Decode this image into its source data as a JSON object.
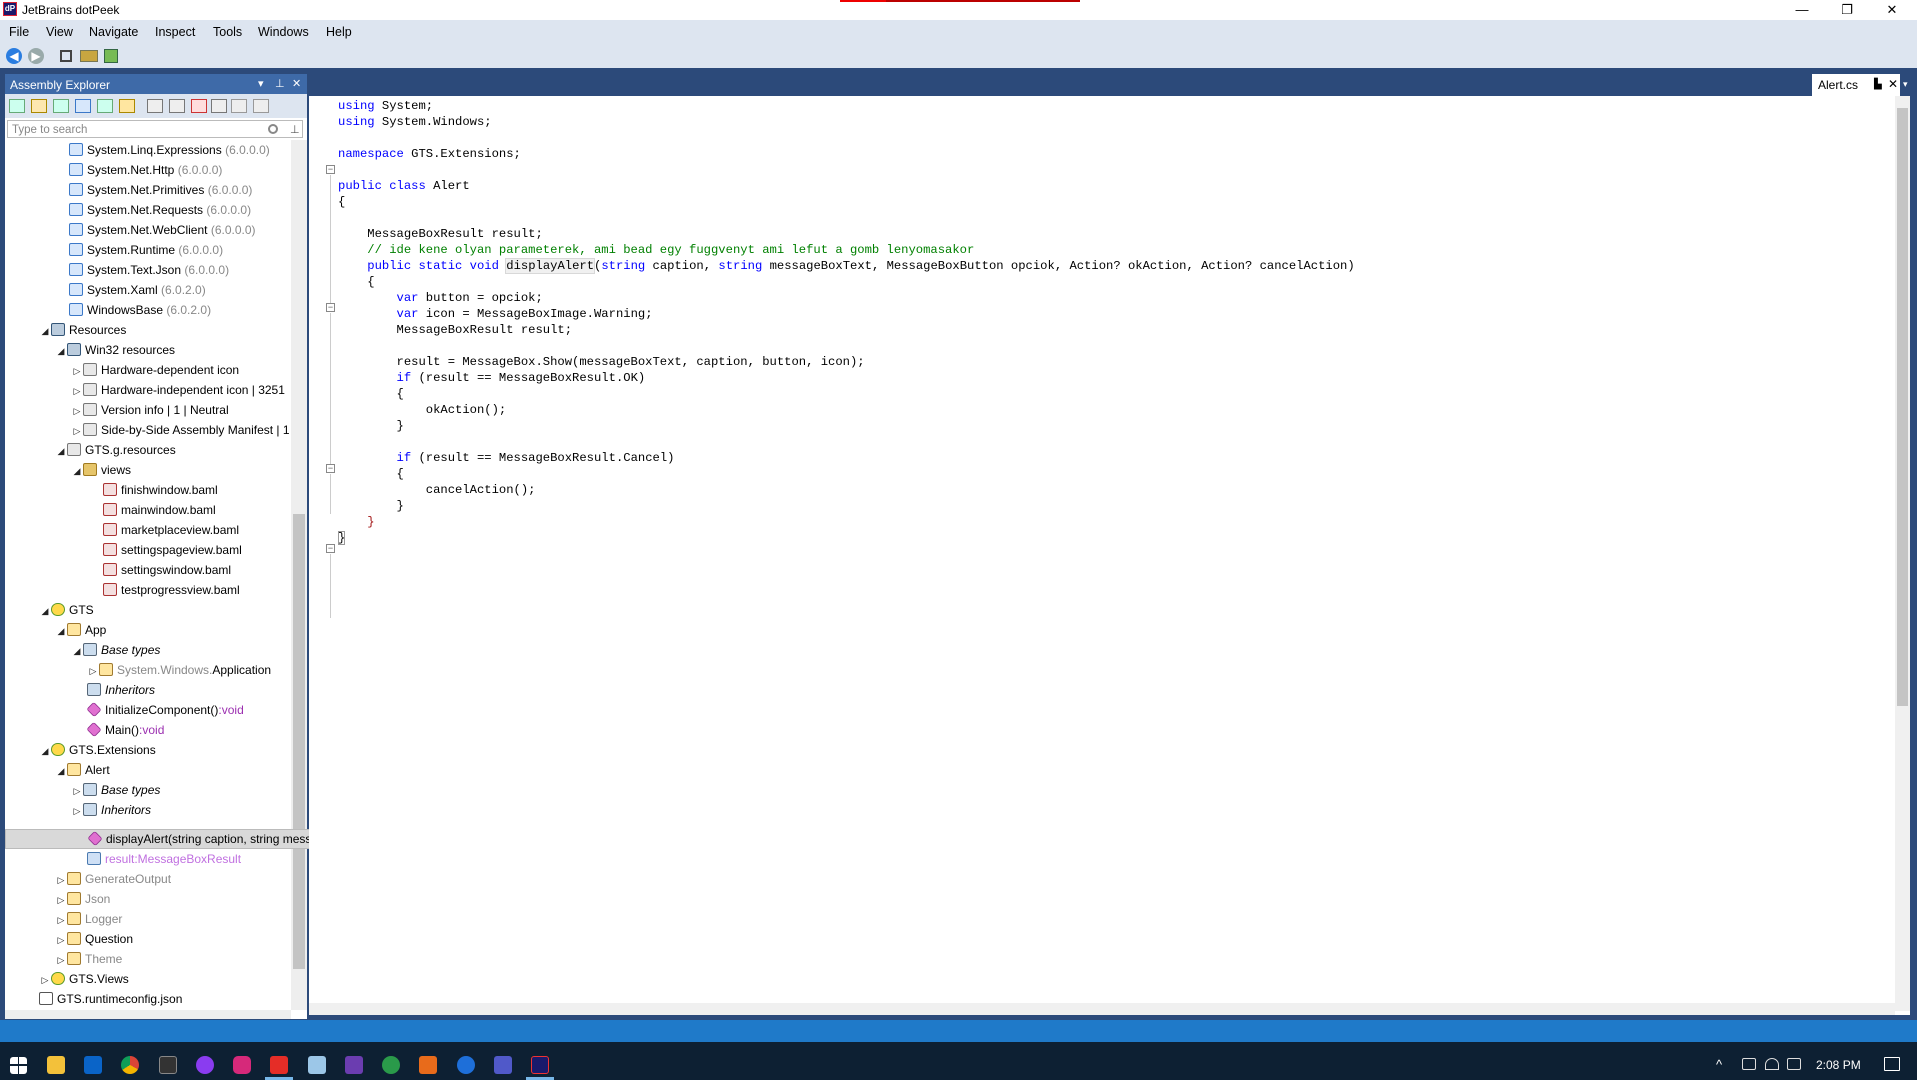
{
  "window": {
    "title": "JetBrains dotPeek",
    "app_icon": "dotpeek-icon",
    "min_label": "—",
    "max_label": "❐",
    "close_label": "✕"
  },
  "menu": [
    "File",
    "View",
    "Navigate",
    "Inspect",
    "Tools",
    "Windows",
    "Help"
  ],
  "toolbar": {
    "back_glyph": "◀",
    "forward_glyph": "▶"
  },
  "explorer": {
    "title": "Assembly Explorer",
    "header_dropdown": "▾",
    "header_pin": "⊥",
    "header_close": "✕",
    "search_placeholder": "Type to search",
    "pin_glyph": "⊥"
  },
  "tree": [
    {
      "name": "System.Linq.Expressions",
      "version": "(6.0.0.0)"
    },
    {
      "name": "System.Net.Http",
      "version": "(6.0.0.0)"
    },
    {
      "name": "System.Net.Primitives",
      "version": "(6.0.0.0)"
    },
    {
      "name": "System.Net.Requests",
      "version": "(6.0.0.0)"
    },
    {
      "name": "System.Net.WebClient",
      "version": "(6.0.0.0)"
    },
    {
      "name": "System.Runtime",
      "version": "(6.0.0.0)"
    },
    {
      "name": "System.Text.Json",
      "version": "(6.0.0.0)"
    },
    {
      "name": "System.Xaml",
      "version": "(6.0.2.0)"
    },
    {
      "name": "WindowsBase",
      "version": "(6.0.2.0)"
    },
    {
      "name": "Resources"
    },
    {
      "name": "Win32 resources"
    },
    {
      "name": "Hardware-dependent icon"
    },
    {
      "name": "Hardware-independent icon | 3251"
    },
    {
      "name": "Version info | 1 | Neutral"
    },
    {
      "name": "Side-by-Side Assembly Manifest | 1"
    },
    {
      "name": "GTS.g.resources"
    },
    {
      "name": "views"
    },
    {
      "name": "finishwindow.baml"
    },
    {
      "name": "mainwindow.baml"
    },
    {
      "name": "marketplaceview.baml"
    },
    {
      "name": "settingspageview.baml"
    },
    {
      "name": "settingswindow.baml"
    },
    {
      "name": "testprogressview.baml"
    },
    {
      "name": "GTS"
    },
    {
      "name": "App"
    },
    {
      "name": "Base types"
    },
    {
      "name_prefix": "System.Windows.",
      "name": "Application"
    },
    {
      "name": "Inheritors"
    },
    {
      "name": "InitializeComponent()",
      "suffix": ":void"
    },
    {
      "name": "Main()",
      "suffix": ":void"
    },
    {
      "name": "GTS.Extensions"
    },
    {
      "name": "Alert"
    },
    {
      "name": "Base types"
    },
    {
      "name": "Inheritors"
    },
    {
      "name": "displayAlert(string caption, string messageBoxText, MessageBoxButton opciok, Action? okAction, Action? cancelAction):void"
    },
    {
      "name": "result:MessageBoxResult"
    },
    {
      "name": "GenerateOutput"
    },
    {
      "name": "Json"
    },
    {
      "name": "Logger"
    },
    {
      "name": "Question"
    },
    {
      "name": "Theme"
    },
    {
      "name": "GTS.Views"
    },
    {
      "name": "GTS.runtimeconfig.json"
    }
  ],
  "editor": {
    "tab_label": "Alert.cs",
    "tab_pin": "▙",
    "tab_close": "✕",
    "tab_dropdown": "▾",
    "code": {
      "l1_kw": "using",
      "l1_rest": " System;",
      "l2_kw": "using",
      "l2_rest": " System.Windows;",
      "l4_kw": "namespace",
      "l4_rest": " GTS.Extensions;",
      "l6_kw1": "public",
      "l6_kw2": " class",
      "l6_rest": " Alert",
      "l7": "{",
      "l9": "    MessageBoxResult result;",
      "l10": "    // ide kene olyan parameterek, ami bead egy fuggvenyt ami lefut a gomb lenyomasakor",
      "l11_indent": "    ",
      "l11_kw": "public static void",
      "l11_sp": " ",
      "l11_name": "displayAlert",
      "l11_p1": "(",
      "l11_t1": "string",
      "l11_p2": " caption, ",
      "l11_t2": "string",
      "l11_p3": " messageBoxText, MessageBoxButton opciok, Action? okAction, Action? cancelAction)",
      "l12": "    {",
      "l13_indent": "        ",
      "l13_kw": "var",
      "l13_rest": " button = opciok;",
      "l14_indent": "        ",
      "l14_kw": "var",
      "l14_rest": " icon = MessageBoxImage.Warning;",
      "l15": "        MessageBoxResult result;",
      "l17": "        result = MessageBox.Show(messageBoxText, caption, button, icon);",
      "l18_indent": "        ",
      "l18_kw": "if",
      "l18_rest": " (result == MessageBoxResult.OK)",
      "l19": "        {",
      "l20": "            okAction();",
      "l21": "        }",
      "l23_indent": "        ",
      "l23_kw": "if",
      "l23_rest": " (result == MessageBoxResult.Cancel)",
      "l24": "        {",
      "l25": "            cancelAction();",
      "l26": "        }",
      "l27_indent": "    ",
      "l27_brace": "}",
      "l28": "}"
    }
  },
  "taskbar": {
    "apps": [
      "file-explorer-icon",
      "outlook-icon",
      "chrome-icon",
      "terminal-icon",
      "messenger-icon",
      "instagram-icon",
      "youtube-icon",
      "notepad-icon",
      "visual-studio-icon",
      "git-icon",
      "office-icon",
      "1password-icon",
      "teams-icon",
      "dotpeek-icon"
    ],
    "tray_chevron": "^",
    "time": "2:08 PM"
  }
}
